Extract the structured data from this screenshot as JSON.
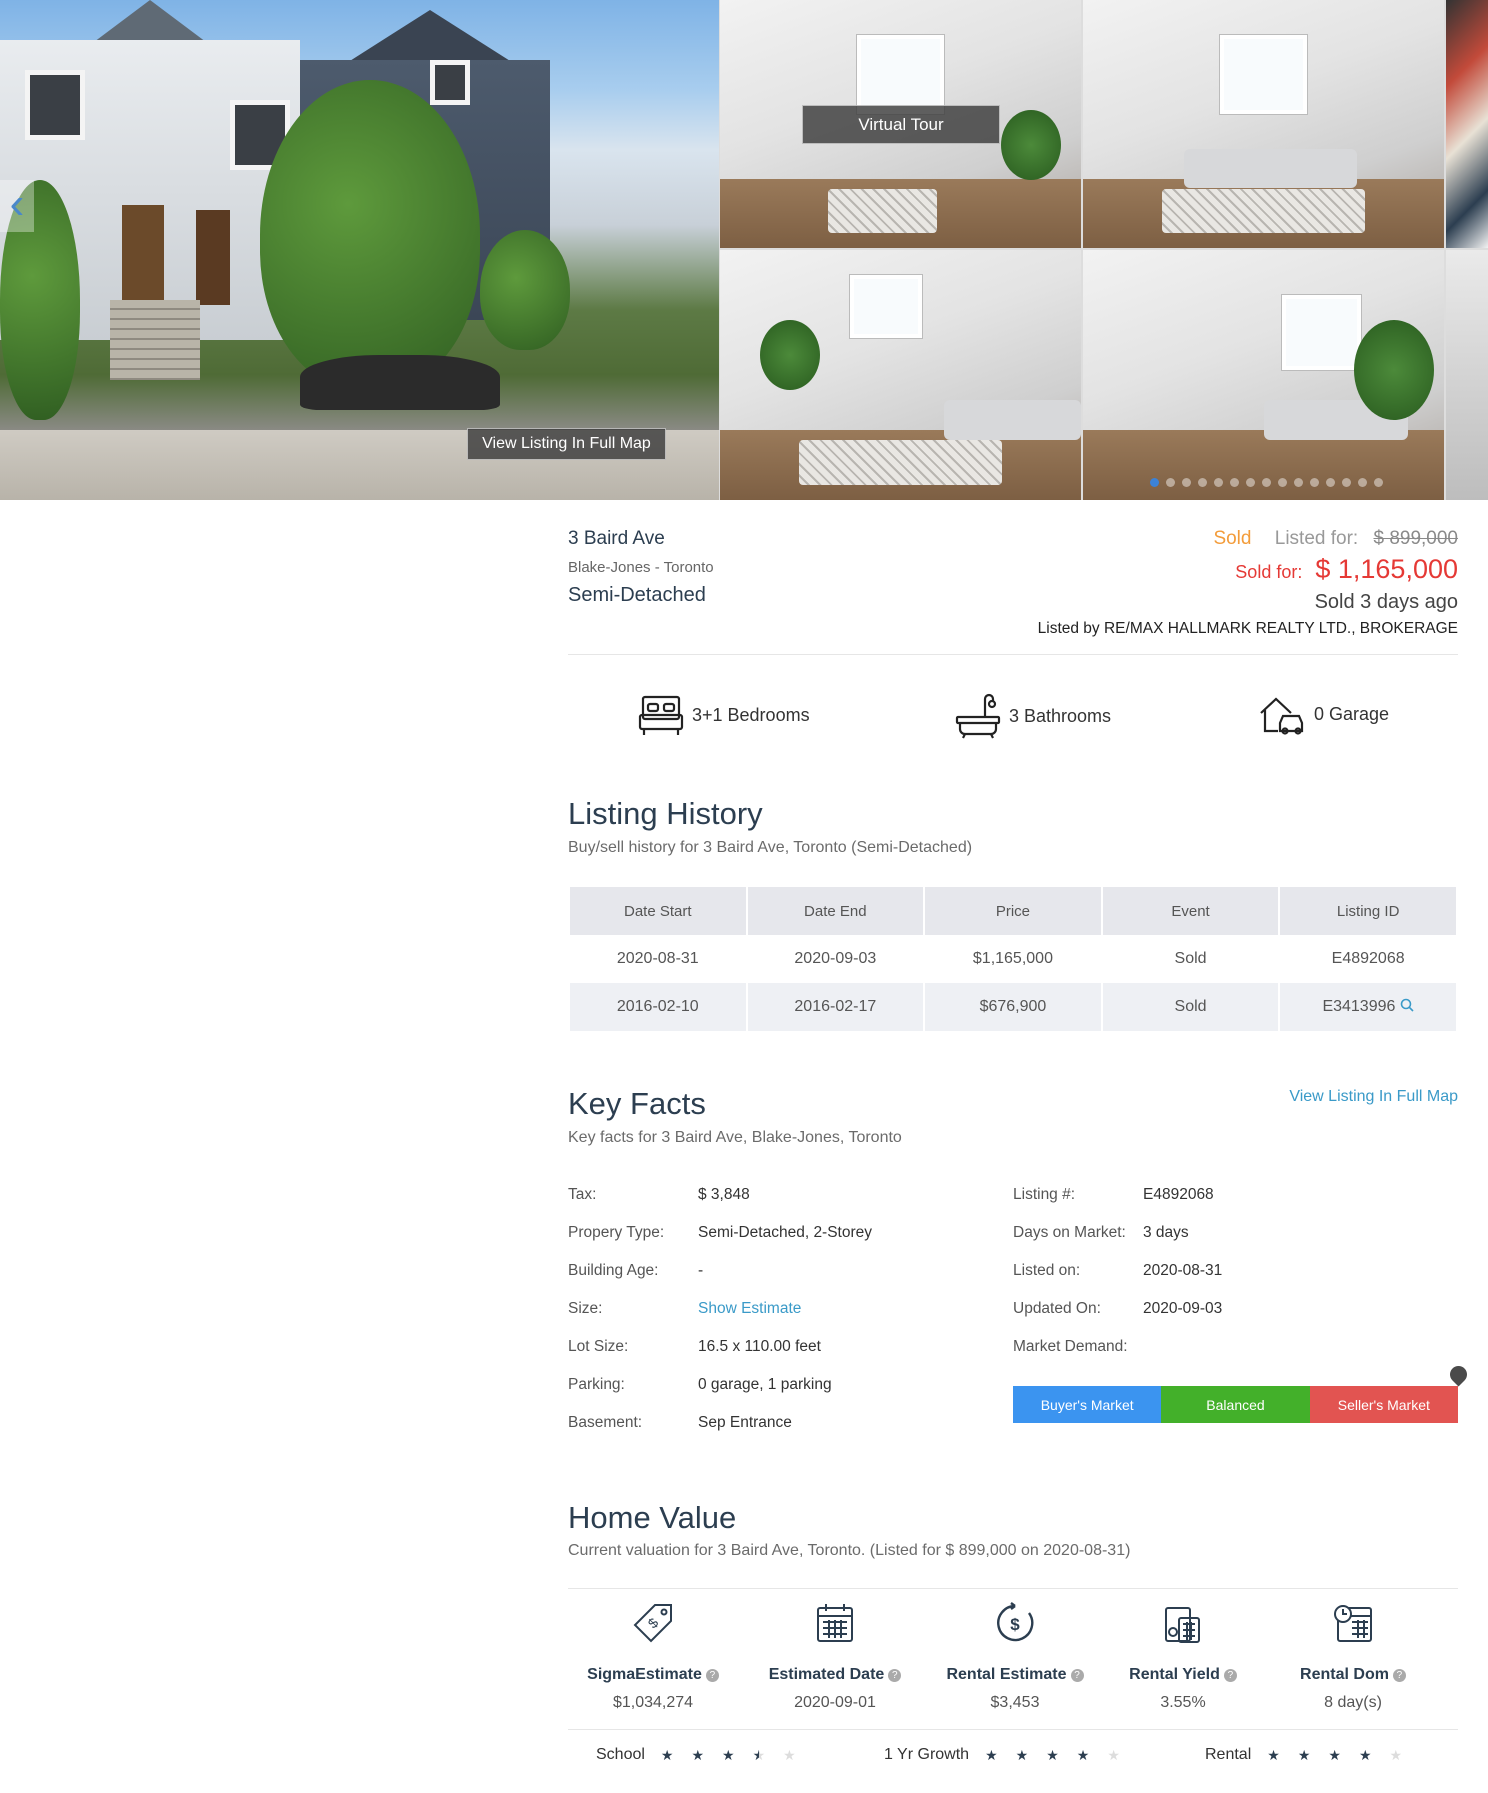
{
  "gallery": {
    "virtual_tour": "Virtual Tour",
    "view_full_map": "View Listing In Full Map",
    "prev_glyph": "‹",
    "dot_count": 15,
    "active_dot": 0
  },
  "listing": {
    "address": "3 Baird Ave",
    "neighborhood": "Blake-Jones - Toronto",
    "property_type": "Semi-Detached",
    "status": "Sold",
    "listed_for_label": "Listed for:",
    "listed_price": "$ 899,000",
    "sold_for_label": "Sold for:",
    "sold_price": "$ 1,165,000",
    "sold_ago": "Sold 3 days ago",
    "listed_by": "Listed by RE/MAX HALLMARK REALTY LTD., BROKERAGE"
  },
  "features": {
    "bedrooms": "3+1 Bedrooms",
    "bathrooms": "3 Bathrooms",
    "garage": "0 Garage"
  },
  "history": {
    "title": "Listing History",
    "subtitle": "Buy/sell history for 3 Baird Ave, Toronto (Semi-Detached)",
    "headers": [
      "Date Start",
      "Date End",
      "Price",
      "Event",
      "Listing ID"
    ],
    "rows": [
      [
        "2020-08-31",
        "2020-09-03",
        "$1,165,000",
        "Sold",
        "E4892068"
      ],
      [
        "2016-02-10",
        "2016-02-17",
        "$676,900",
        "Sold",
        "E3413996"
      ]
    ]
  },
  "key_facts": {
    "title": "Key Facts",
    "subtitle": "Key facts for 3 Baird Ave, Blake-Jones, Toronto",
    "map_link": "View Listing In Full Map",
    "left": [
      {
        "label": "Tax:",
        "value": "$ 3,848"
      },
      {
        "label": "Propery Type:",
        "value": "Semi-Detached, 2-Storey"
      },
      {
        "label": "Building Age:",
        "value": "-"
      },
      {
        "label": "Size:",
        "value": "Show Estimate"
      },
      {
        "label": "Lot Size:",
        "value": "16.5 x 110.00 feet"
      },
      {
        "label": "Parking:",
        "value": "0 garage, 1 parking"
      },
      {
        "label": "Basement:",
        "value": "Sep Entrance"
      }
    ],
    "right": [
      {
        "label": "Listing #:",
        "value": "E4892068"
      },
      {
        "label": "Days on Market:",
        "value": "3 days"
      },
      {
        "label": "Listed on:",
        "value": "2020-08-31"
      },
      {
        "label": "Updated On:",
        "value": "2020-09-03"
      },
      {
        "label": "Market Demand:",
        "value": ""
      }
    ],
    "market": {
      "buyer": "Buyer's Market",
      "balanced": "Balanced",
      "seller": "Seller's Market",
      "indicator_level": 1.0
    }
  },
  "home_value": {
    "title": "Home Value",
    "subtitle": "Current valuation for 3 Baird Ave, Toronto. (Listed for $ 899,000 on 2020-08-31)",
    "items": [
      {
        "label": "SigmaEstimate",
        "value": "$1,034,274",
        "icon": "price-tag-icon"
      },
      {
        "label": "Estimated Date",
        "value": "2020-09-01",
        "icon": "calendar-icon"
      },
      {
        "label": "Rental Estimate",
        "value": "$3,453",
        "icon": "dollar-cycle-icon"
      },
      {
        "label": "Rental Yield",
        "value": "3.55%",
        "icon": "calculator-icon"
      },
      {
        "label": "Rental Dom",
        "value": "8 day(s)",
        "icon": "calendar-clock-icon"
      }
    ],
    "help_glyph": "?",
    "ratings": [
      {
        "label": "School",
        "stars": 3.5
      },
      {
        "label": "1 Yr Growth",
        "stars": 4
      },
      {
        "label": "Rental",
        "stars": 4
      }
    ]
  },
  "colors": {
    "heading": "#2c3e50",
    "link": "#3a9ac8",
    "sold_orange": "#f39c3a",
    "sold_red": "#e53935",
    "buyer_blue": "#3b94f0",
    "balanced_green": "#43b02a",
    "seller_red": "#e25451"
  }
}
